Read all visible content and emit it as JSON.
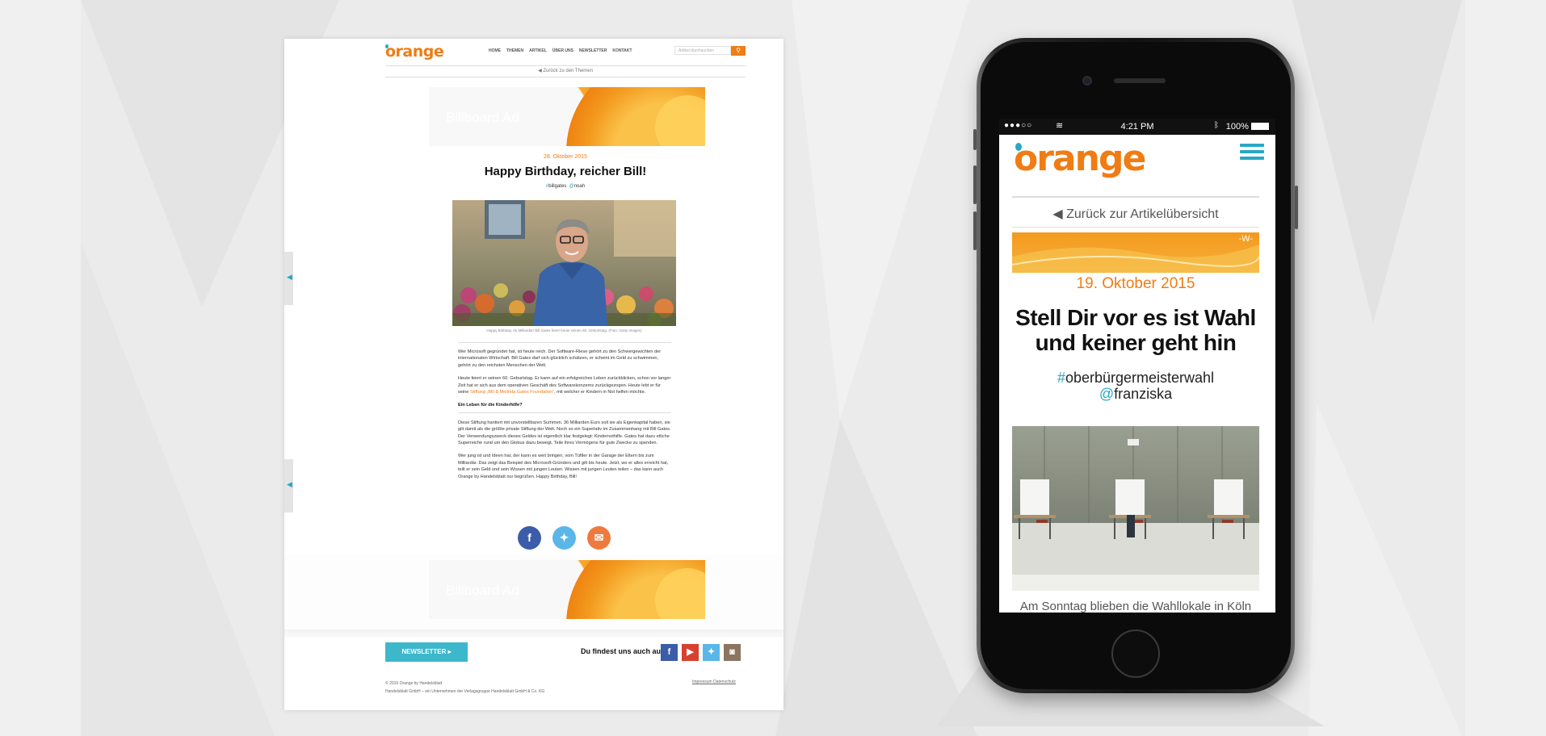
{
  "desktop": {
    "logo": "orange",
    "nav_items": [
      "HOME",
      "THEMEN",
      "ARTIKEL",
      "ÜBER UNS",
      "NEWSLETTER",
      "KONTAKT"
    ],
    "search_placeholder": "Artikel durchsuchen",
    "back_link": "◀ Zurück zu den Themen",
    "billboard_label": "Billboard Ad",
    "date": "28. Oktober 2015",
    "title": "Happy Birthday, reicher Bill!",
    "tag1_mark": "#",
    "tag1": "billgates",
    "tag2_mark": "@",
    "tag2": "noah",
    "photo_caption": "Happy Birthday, du Milliardär! Bill Gates feiert heute seinen 60. Geburtstag. (Foto: Getty Images)",
    "paragraph1": "Wer Microsoft gegründet hat, ist heute reich. Der Software-Riese gehört zu den Schwergewichten der internationalen Wirtschaft. Bill Gates darf sich glücklich schätzen, er scheint im Geld zu schwimmen, gehört zu den reichsten Menschen der Welt.",
    "paragraph2_start": "Heute feiert er seinen 60. Geburtstag. Er kann auf ein erfolgreiches Leben zurückblicken, schon vor langer Zeit hat er sich aus dem operativen Geschäft des Softwarekonzerns zurückgezogen. Heute lebt er für seine ",
    "paragraph2_link": "Stiftung „Bill & Melinda Gates Foundation“",
    "paragraph2_end": ", mit welcher er Kindern in Not helfen möchte.",
    "subheading": "Ein Leben für die Kinderhilfe?",
    "paragraph3": "Diese Stiftung hantiert mit unvorstellbaren Summen. 36 Milliarden Euro soll sie als Eigenkapital haben, sie gilt damit als die größte private Stiftung der Welt. Noch so ein Superlativ im Zusammenhang mit Bill Gates. Der Verwendungszweck dieses Geldes ist eigentlich klar festgelegt: Kindernothilfe. Gates hat dazu etliche Superreiche rund um den Globus dazu bewegt, Teile ihres Vermögens für gute Zwecke zu spenden.",
    "paragraph4": "Wer jung ist und Ideen hat, der kann es weit bringen, vom Tüftler in der Garage der Eltern bis zum Milliardär. Das zeigt das Beispiel des Microsoft-Gründers und gilt bis heute. Jetzt, wo er alles erreicht hat, teilt er sein Geld und sein Wissen mit jungen Leuten. Wissen mit jungen Leuten teilen – das kann auch Orange by Handelsblatt nur begrüßen. Happy Birthday, Bill!",
    "share_icons": [
      "facebook-icon",
      "twitter-icon",
      "mail-icon"
    ],
    "newsletter_button": "NEWSLETTER ▸",
    "find_us": "Du findest uns auch auf",
    "social_icons": [
      "facebook-icon",
      "youtube-icon",
      "twitter-icon",
      "instagram-icon"
    ],
    "copyright1": "© 2015 Orange by Handelsblatt",
    "copyright2": "Handelsblatt GmbH – ein Unternehmen der Verlagsgruppe Handelsblatt GmbH & Co. KG",
    "impressum": "Impressum",
    "datenschutz": "Datenschutz"
  },
  "mobile": {
    "status_signal": "●●●○○",
    "time": "4:21 PM",
    "battery": "100%",
    "logo": "orange",
    "back_link": "◀ Zurück zur Artikelübersicht",
    "banner_mark": "-W-",
    "date": "19. Oktober 2015",
    "title": "Stell Dir vor es ist Wahl und keiner geht hin",
    "tag1_mark": "#",
    "tag1": "oberbürgermeisterwahl",
    "tag2_mark": "@",
    "tag2": "franziska",
    "lead": "Am Sonntag blieben die Wahllokale in Köln"
  },
  "colors": {
    "brand_orange": "#f07c14",
    "accent_cyan": "#27a8c4",
    "newsletter_teal": "#3cb7cc"
  }
}
